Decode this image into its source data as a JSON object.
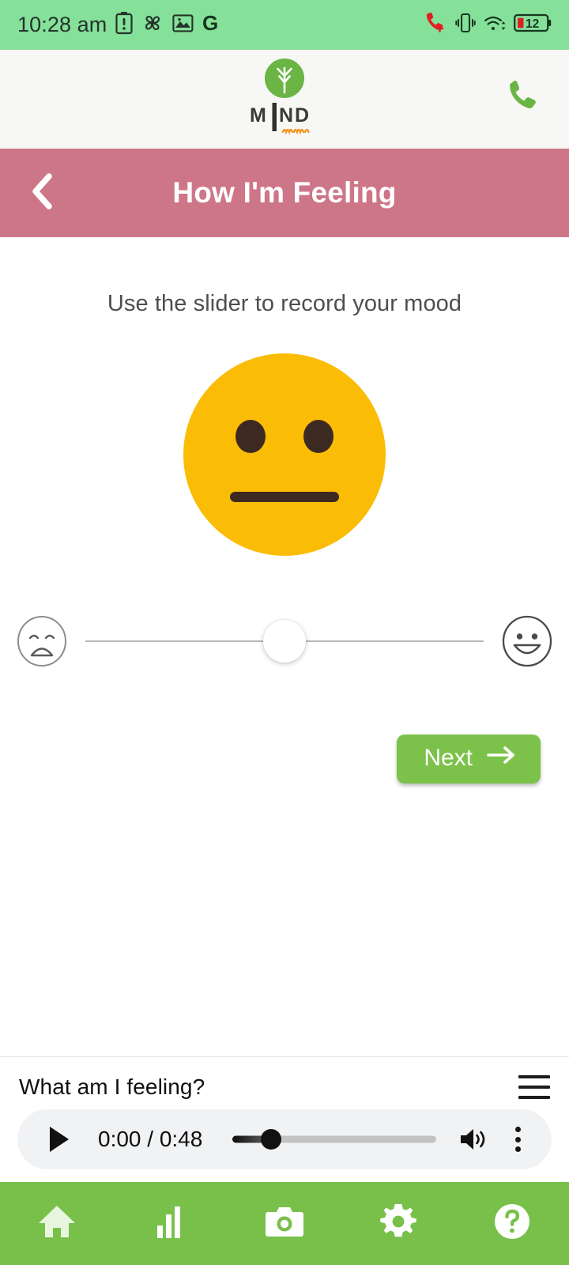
{
  "status_bar": {
    "time": "10:28 am",
    "battery_percent": "12",
    "left_icons": [
      "battery-alert-icon",
      "fan-icon",
      "image-icon",
      "google-g-icon"
    ],
    "right_icons": [
      "missed-call-icon",
      "vibrate-icon",
      "wifi-icon",
      "battery-icon"
    ],
    "background_color": "#85e09a"
  },
  "brand_bar": {
    "logo_name": "MIND",
    "logo_subtext": "mum",
    "logo_icon": "tree-logo-icon",
    "call_icon": "phone-icon",
    "accent_green": "#6ab544",
    "accent_orange": "#f0941f",
    "background_color": "#f7f7f5"
  },
  "app_bar": {
    "title": "How I'm Feeling",
    "back_icon": "chevron-left-icon",
    "background_color": "#cd7688"
  },
  "main": {
    "instruction": "Use the slider to record your mood",
    "emoji": {
      "name": "neutral-face-emoji",
      "face_color": "#fbbc05",
      "feature_color": "#3c2a22"
    },
    "slider": {
      "min_icon": "sad-face-icon",
      "max_icon": "happy-face-icon",
      "value_percent": 50,
      "track_color": "#b8b8b8",
      "thumb_color": "#ffffff"
    },
    "next_button": {
      "label": "Next",
      "icon": "arrow-right-icon",
      "color": "#7cc24a"
    }
  },
  "audio_player": {
    "title": "What am I feeling?",
    "menu_icon": "hamburger-menu-icon",
    "play_icon": "play-icon",
    "current_time": "0:00",
    "total_time": "0:48",
    "time_display": "0:00 / 0:48",
    "progress_percent": 19,
    "volume_icon": "volume-icon",
    "more_icon": "more-vertical-icon",
    "background_color": "#f1f2f3"
  },
  "bottom_nav": {
    "background_color": "#78c04a",
    "items": [
      {
        "name": "home",
        "icon": "home-icon"
      },
      {
        "name": "stats",
        "icon": "bar-chart-icon"
      },
      {
        "name": "camera",
        "icon": "camera-icon"
      },
      {
        "name": "settings",
        "icon": "gear-icon"
      },
      {
        "name": "help",
        "icon": "help-circle-icon"
      }
    ]
  }
}
